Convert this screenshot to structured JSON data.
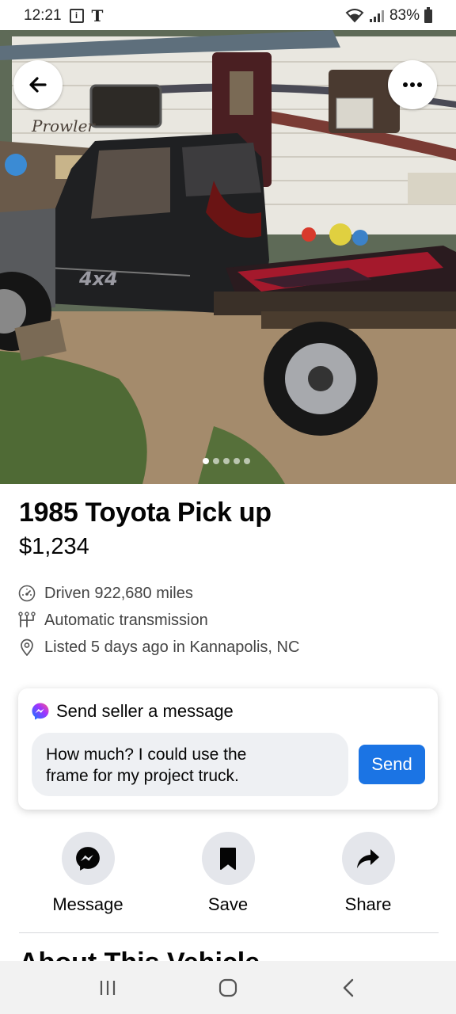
{
  "status_bar": {
    "time": "12:21",
    "carrier_icon": "t-mobile-icon",
    "battery_percent": "83%"
  },
  "photo": {
    "trailer_brand_text": "Prowler",
    "truck_decal_text": "4x4",
    "dot_count": 5,
    "active_dot": 0
  },
  "listing": {
    "title": "1985 Toyota Pick up",
    "price": "$1,234",
    "details": [
      {
        "icon": "speedometer-icon",
        "text": "Driven 922,680 miles"
      },
      {
        "icon": "gearshift-icon",
        "text": "Automatic transmission"
      },
      {
        "icon": "location-pin-icon",
        "text": "Listed 5 days ago in Kannapolis, NC"
      }
    ]
  },
  "message_card": {
    "heading": "Send seller a message",
    "input_line1": "How much? I could use the",
    "input_line2": "frame for my project truck.",
    "send_label": "Send"
  },
  "actions": [
    {
      "icon": "messenger-icon",
      "label": "Message"
    },
    {
      "icon": "bookmark-icon",
      "label": "Save"
    },
    {
      "icon": "share-icon",
      "label": "Share"
    }
  ],
  "section_peek": "About This Vehicle",
  "colors": {
    "accent": "#1b74e4",
    "circle_bg": "#e4e6eb",
    "input_bg": "#eef0f3"
  }
}
